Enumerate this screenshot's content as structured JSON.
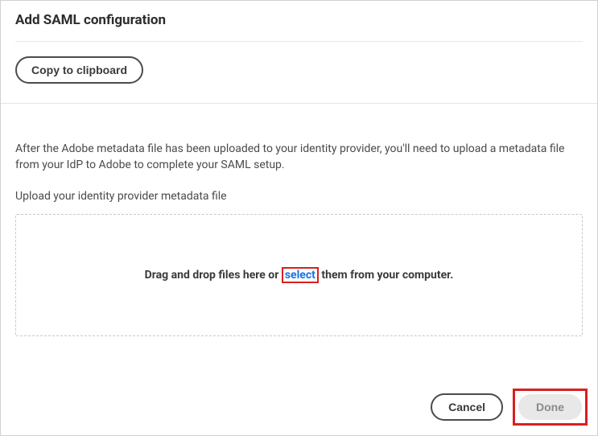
{
  "title": "Add SAML configuration",
  "toolbar": {
    "copy_label": "Copy to clipboard"
  },
  "content": {
    "description": "After the Adobe metadata file has been uploaded to your identity provider, you'll need to upload a metadata file from your IdP to Adobe to complete your SAML setup.",
    "upload_label": "Upload your identity provider metadata file",
    "dropzone": {
      "prefix": "Drag and drop files here or ",
      "select": "select",
      "suffix": " them from your computer."
    }
  },
  "footer": {
    "cancel_label": "Cancel",
    "done_label": "Done"
  },
  "highlight": {
    "select_link": true,
    "done_button": true
  }
}
